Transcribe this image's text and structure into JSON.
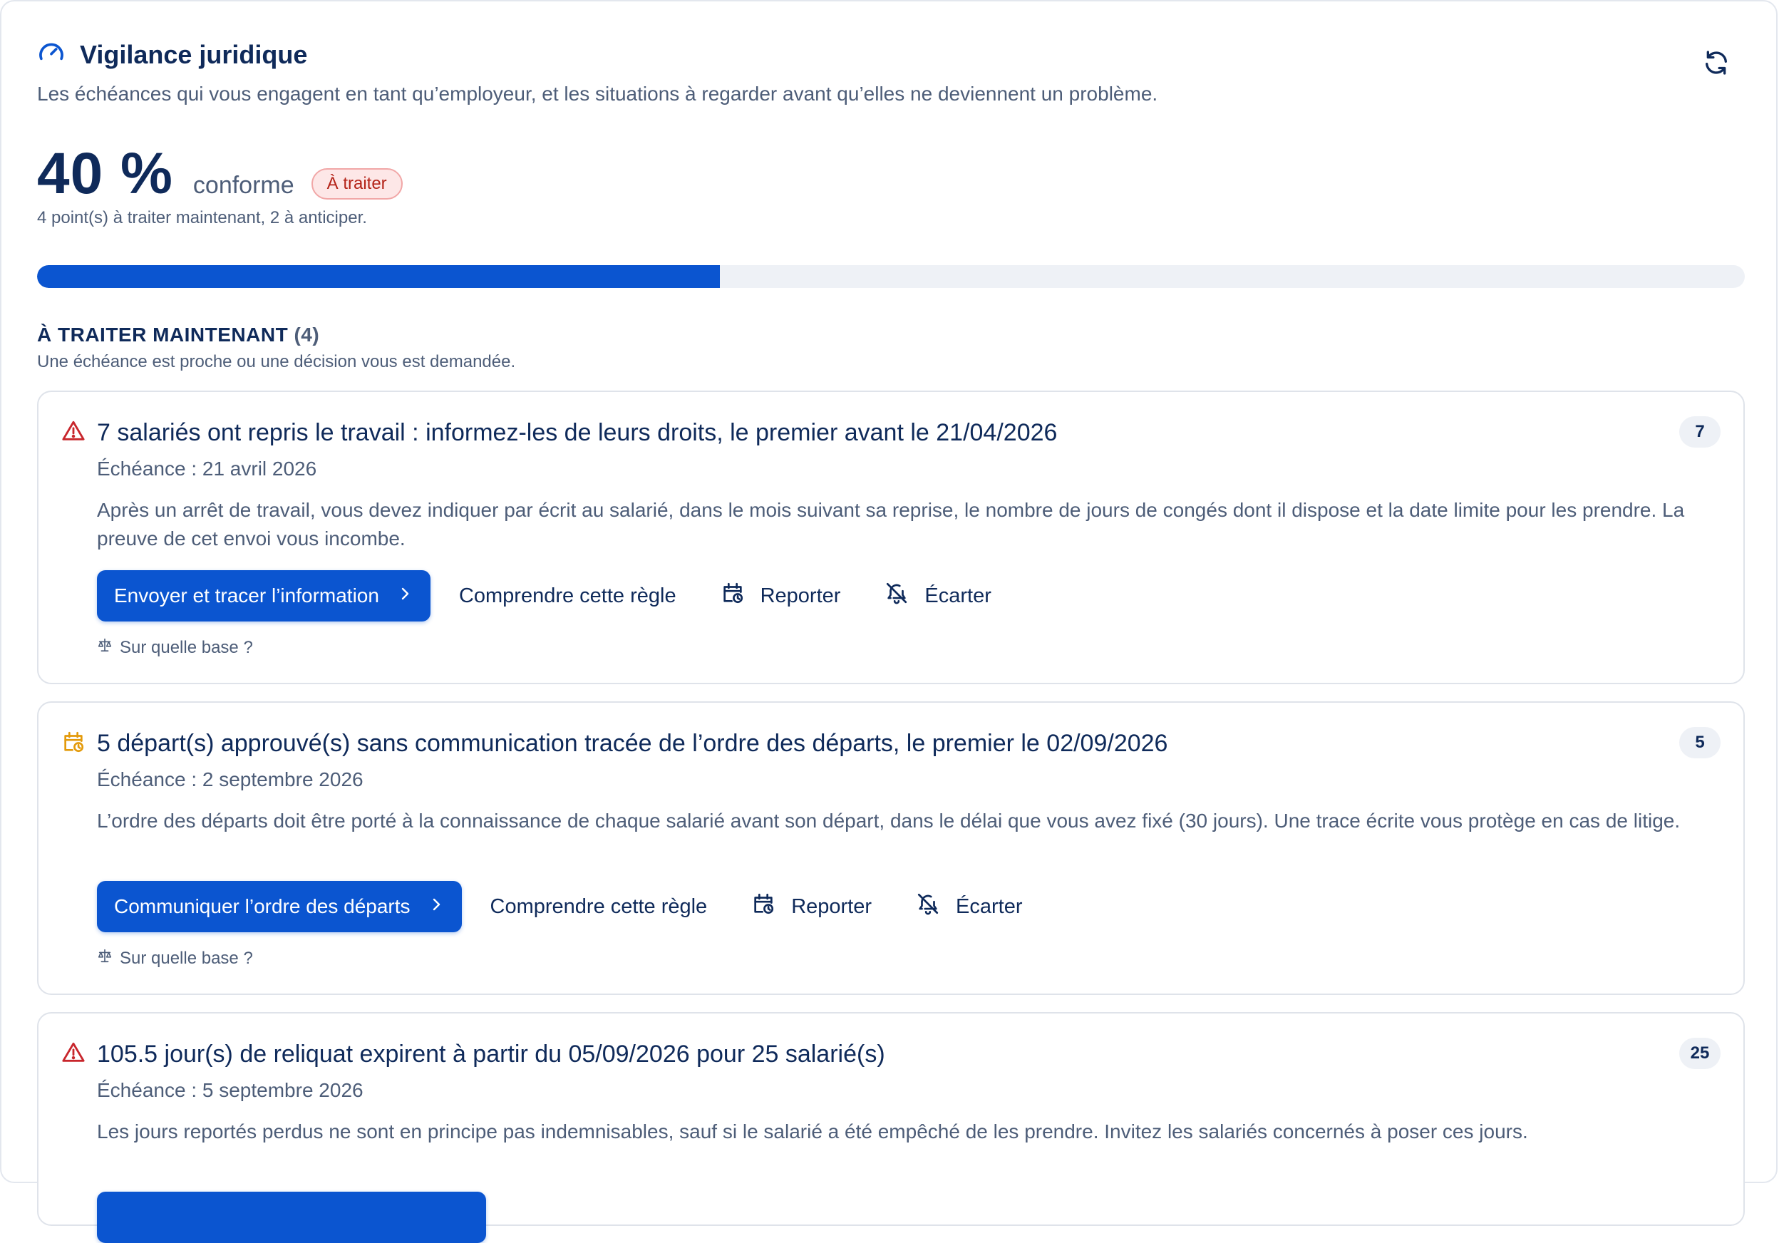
{
  "header": {
    "title": "Vigilance juridique",
    "subtitle": "Les échéances qui vous engagent en tant qu’employeur, et les situations à regarder avant qu’elles ne deviennent un problème.",
    "refresh_icon": "refresh-icon",
    "title_icon": "gauge-icon"
  },
  "score": {
    "value": "40 %",
    "label": "conforme",
    "badge": "À traiter",
    "summary": "4 point(s) à traiter maintenant, 2 à anticiper.",
    "progress_fraction": 0.4
  },
  "section": {
    "title": "À TRAITER MAINTENANT",
    "count": "(4)",
    "subtitle": "Une échéance est proche ou une décision vous est demandée."
  },
  "cards": [
    {
      "icon": "warning-icon",
      "title": "7 salariés ont repris le travail : informez-les de leurs droits, le premier avant le 21/04/2026",
      "count": "7",
      "due": "Échéance : 21 avril 2026",
      "description": "Après un arrêt de travail, vous devez indiquer par écrit au salarié, dans le mois suivant sa reprise, le nombre de jours de congés dont il dispose et la date limite pour les prendre. La preuve de cet envoi vous incombe.",
      "primary_action": "Envoyer et tracer l’information",
      "understand": "Comprendre cette règle",
      "postpone": "Reporter",
      "dismiss": "Écarter",
      "basis": "Sur quelle base ?"
    },
    {
      "icon": "calendar-clock-icon",
      "title": "5 départ(s) approuvé(s) sans communication tracée de l’ordre des départs, le premier le 02/09/2026",
      "count": "5",
      "due": "Échéance : 2 septembre 2026",
      "description": "L’ordre des départs doit être porté à la connaissance de chaque salarié avant son départ, dans le délai que vous avez fixé (30 jours). Une trace écrite vous protège en cas de litige.",
      "primary_action": "Communiquer l’ordre des départs",
      "understand": "Comprendre cette règle",
      "postpone": "Reporter",
      "dismiss": "Écarter",
      "basis": "Sur quelle base ?"
    },
    {
      "icon": "warning-icon",
      "title": "105.5 jour(s) de reliquat expirent à partir du 05/09/2026 pour 25 salarié(s)",
      "count": "25",
      "due": "Échéance : 5 septembre 2026",
      "description": "Les jours reportés perdus ne sont en principe pas indemnisables, sauf si le salarié a été empêché de les prendre. Invitez les salariés concernés à poser ces jours."
    }
  ],
  "colors": {
    "accent": "#0b55d0",
    "danger": "#c8262c",
    "warning": "#e39a0b",
    "text": "#0f2a5a",
    "muted": "#4d5d78"
  }
}
